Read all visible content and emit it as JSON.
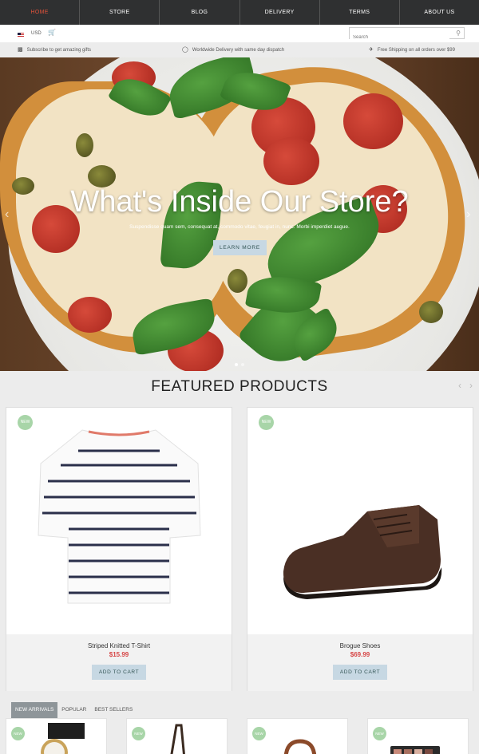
{
  "nav": {
    "items": [
      {
        "label": "HOME",
        "active": true
      },
      {
        "label": "STORE",
        "active": false
      },
      {
        "label": "BLOG",
        "active": false
      },
      {
        "label": "DELIVERY",
        "active": false
      },
      {
        "label": "TERMS",
        "active": false
      },
      {
        "label": "ABOUT US",
        "active": false
      }
    ]
  },
  "utility": {
    "currency": "USD",
    "search_placeholder": "Search"
  },
  "info": {
    "subscribe": "Subscribe to get amazing gifts",
    "delivery": "Worldwide Delivery with same day dispatch",
    "shipping": "Free Shipping on all orders over $99"
  },
  "hero": {
    "title": "What's Inside Our Store?",
    "subtitle": "Suspendisse quam sem, consequat at, commodo vitae, feugiat in, nunc. Morbi imperdiet augue.",
    "button": "LEARN MORE"
  },
  "featured": {
    "title": "FEATURED PRODUCTS",
    "products": [
      {
        "badge": "NEW",
        "name": "Striped Knitted T-Shirt",
        "price": "$15.99",
        "button": "ADD TO CART"
      },
      {
        "badge": "NEW",
        "name": "Brogue Shoes",
        "price": "$69.99",
        "button": "ADD TO CART"
      }
    ]
  },
  "tabs": {
    "items": [
      {
        "label": "NEW ARRIVALS",
        "active": true
      },
      {
        "label": "POPULAR",
        "active": false
      },
      {
        "label": "BEST SELLERS",
        "active": false
      }
    ],
    "badges": [
      "NEW",
      "NEW",
      "NEW",
      "NEW"
    ]
  },
  "colors": {
    "nav_bg": "#2f3031",
    "nav_active": "#e0523a",
    "button_bg": "#c7d8e3",
    "price": "#d64545",
    "badge": "#a8d5a8"
  }
}
